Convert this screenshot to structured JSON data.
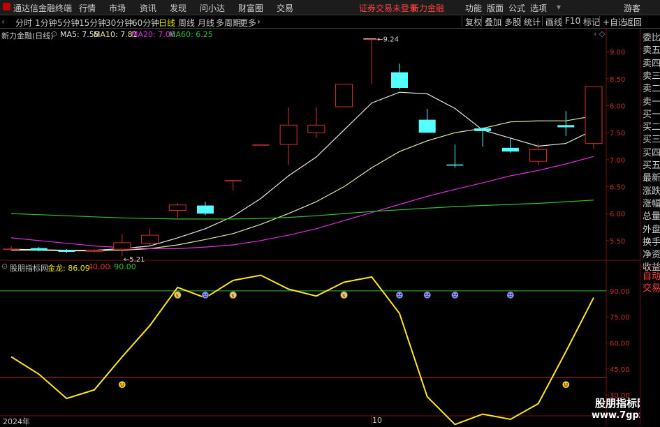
{
  "menubar": {
    "app_title": "通达信金融终端",
    "items": [
      "行情",
      "市场",
      "资讯",
      "发现",
      "问小达",
      "财富圈",
      "交易"
    ],
    "notice": "证券交易未登录",
    "notice_stock": "新力金融",
    "right_items": [
      "功能",
      "版面",
      "公式",
      "选项"
    ],
    "user": "游客"
  },
  "toolbar": {
    "periods": [
      "分时",
      "1分钟",
      "5分钟",
      "15分钟",
      "30分钟",
      "60分钟",
      "日线",
      "周线",
      "月线",
      "多周期",
      "更多"
    ],
    "active_period": "日线",
    "buttons": [
      "复权",
      "叠加",
      "多股",
      "统计",
      "画线",
      "F10",
      "标记",
      "+自选",
      "返回"
    ]
  },
  "main_chart": {
    "stock_label": "新力金融(日线)",
    "ma": [
      {
        "name": "MA5",
        "value": "7.55",
        "color": "#e8e8e8"
      },
      {
        "name": "MA10",
        "value": "7.81",
        "color": "#e8e8a0"
      },
      {
        "name": "MA20",
        "value": "7.06",
        "color": "#e030e0"
      },
      {
        "name": "MA60",
        "value": "6.25",
        "color": "#30c030"
      }
    ],
    "high_marker": "9.24",
    "low_marker": "5.21",
    "price_axis": [
      "9.00",
      "8.50",
      "8.00",
      "7.50",
      "7.00",
      "6.50",
      "6.00",
      "5.50"
    ]
  },
  "indicator": {
    "name": "股朋指标网",
    "line_name": "金龙",
    "line_value": "86.09",
    "levels_label_a": "40.00",
    "levels_label_b": "90.00",
    "axis": [
      "90.00",
      "75.00",
      "60.00",
      "45.00",
      "30.00"
    ]
  },
  "date_axis": {
    "start": "2024年",
    "mid": "10"
  },
  "sidebar": {
    "items": [
      "委比",
      "卖五",
      "卖四",
      "卖三",
      "卖二",
      "卖一",
      "买一",
      "买二",
      "买三",
      "买四",
      "买五",
      "最新",
      "涨跌",
      "涨幅",
      "总量",
      "外盘",
      "换手",
      "净资",
      "收益"
    ],
    "bottom_items": [
      "自动",
      "交易"
    ]
  },
  "watermark": {
    "title": "股朋指标网",
    "url": "www.7gpzb.com"
  },
  "chart_data": [
    {
      "type": "candlestick",
      "title": "新力金融(日线)",
      "ylim": [
        5.2,
        9.3
      ],
      "candles": [
        {
          "o": 5.35,
          "c": 5.35,
          "h": 5.4,
          "l": 5.3
        },
        {
          "o": 5.36,
          "c": 5.32,
          "h": 5.38,
          "l": 5.3
        },
        {
          "o": 5.32,
          "c": 5.29,
          "h": 5.34,
          "l": 5.27
        },
        {
          "o": 5.3,
          "c": 5.32,
          "h": 5.34,
          "l": 5.28
        },
        {
          "o": 5.34,
          "c": 5.46,
          "h": 5.62,
          "l": 5.21
        },
        {
          "o": 5.45,
          "c": 5.6,
          "h": 5.72,
          "l": 5.4
        },
        {
          "o": 6.06,
          "c": 6.16,
          "h": 6.2,
          "l": 5.9
        },
        {
          "o": 6.15,
          "c": 6.0,
          "h": 6.22,
          "l": 5.97
        },
        {
          "o": 6.62,
          "c": 6.62,
          "h": 6.62,
          "l": 6.43
        },
        {
          "o": 7.28,
          "c": 7.28,
          "h": 7.28,
          "l": 7.28
        },
        {
          "o": 7.28,
          "c": 7.64,
          "h": 7.97,
          "l": 6.9
        },
        {
          "o": 7.5,
          "c": 7.64,
          "h": 7.97,
          "l": 7.4
        },
        {
          "o": 7.98,
          "c": 8.4,
          "h": 8.4,
          "l": 7.98
        },
        {
          "o": 9.24,
          "c": 9.24,
          "h": 9.24,
          "l": 8.4
        },
        {
          "o": 8.62,
          "c": 8.33,
          "h": 8.78,
          "l": 8.3
        },
        {
          "o": 7.74,
          "c": 7.5,
          "h": 7.94,
          "l": 7.5
        },
        {
          "o": 6.91,
          "c": 6.89,
          "h": 7.28,
          "l": 6.85
        },
        {
          "o": 7.58,
          "c": 7.53,
          "h": 7.6,
          "l": 7.24
        },
        {
          "o": 7.22,
          "c": 7.15,
          "h": 7.4,
          "l": 7.13
        },
        {
          "o": 6.97,
          "c": 7.19,
          "h": 7.3,
          "l": 6.9
        },
        {
          "o": 7.64,
          "c": 7.6,
          "h": 7.9,
          "l": 7.44
        },
        {
          "o": 7.3,
          "c": 8.35,
          "h": 8.35,
          "l": 7.2
        }
      ],
      "series": [
        {
          "name": "MA5",
          "values": [
            5.34,
            5.33,
            5.32,
            5.32,
            5.35,
            5.4,
            5.55,
            5.72,
            5.95,
            6.28,
            6.7,
            7.05,
            7.55,
            8.05,
            8.25,
            8.22,
            7.95,
            7.55,
            7.4,
            7.25,
            7.3,
            7.55
          ]
        },
        {
          "name": "MA10",
          "values": [
            5.32,
            5.32,
            5.31,
            5.31,
            5.32,
            5.35,
            5.42,
            5.52,
            5.63,
            5.8,
            6.0,
            6.22,
            6.5,
            6.85,
            7.15,
            7.35,
            7.5,
            7.58,
            7.7,
            7.72,
            7.72,
            7.81
          ]
        },
        {
          "name": "MA20",
          "values": [
            5.55,
            5.5,
            5.45,
            5.4,
            5.37,
            5.35,
            5.35,
            5.38,
            5.42,
            5.5,
            5.6,
            5.72,
            5.87,
            6.02,
            6.17,
            6.32,
            6.45,
            6.57,
            6.7,
            6.8,
            6.92,
            7.06
          ]
        },
        {
          "name": "MA60",
          "values": [
            6.0,
            5.98,
            5.96,
            5.94,
            5.92,
            5.91,
            5.9,
            5.9,
            5.9,
            5.91,
            5.93,
            5.96,
            6.0,
            6.04,
            6.07,
            6.1,
            6.13,
            6.15,
            6.17,
            6.19,
            6.22,
            6.25
          ]
        }
      ]
    },
    {
      "type": "line",
      "title": "股朋指标网",
      "ylim": [
        18,
        102
      ],
      "series": [
        {
          "name": "金龙",
          "values": [
            52,
            42,
            28,
            33,
            52,
            70,
            92,
            86,
            96,
            99,
            91,
            87,
            95,
            98,
            77,
            29,
            13,
            19,
            16,
            25,
            55,
            86.09
          ]
        }
      ],
      "levels": [
        40,
        90
      ],
      "up_markers": [
        6,
        8,
        12
      ],
      "down_markers": [
        7,
        14,
        15,
        16,
        18
      ],
      "smile_markers": [
        {
          "i": 4,
          "v": 36
        },
        {
          "i": 20,
          "v": 36
        }
      ]
    }
  ]
}
